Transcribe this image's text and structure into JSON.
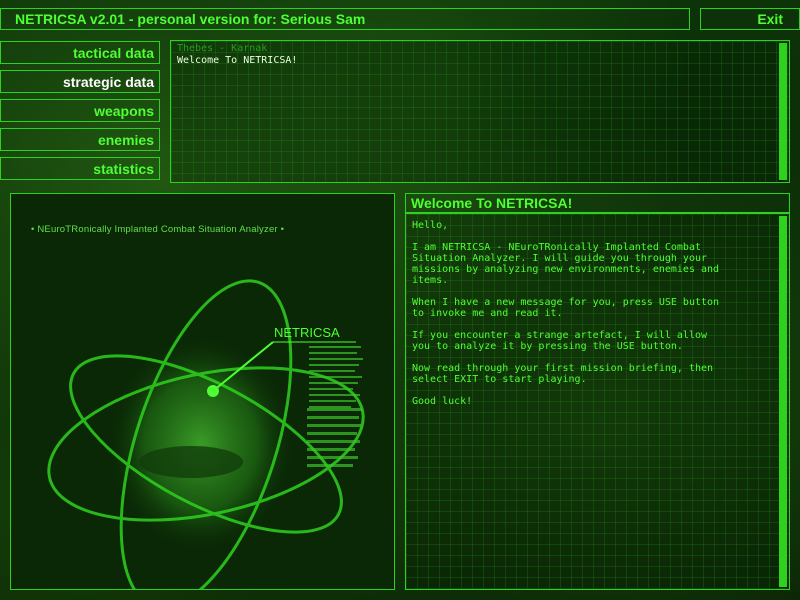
{
  "header": {
    "title": "NETRICSA v2.01 - personal version for: Serious Sam",
    "exit_label": "Exit"
  },
  "nav": {
    "items": [
      {
        "label": "tactical data",
        "active": false
      },
      {
        "label": "strategic data",
        "active": true
      },
      {
        "label": "weapons",
        "active": false
      },
      {
        "label": "enemies",
        "active": false
      },
      {
        "label": "statistics",
        "active": false
      }
    ]
  },
  "messages": {
    "location": "Thebes - Karnak",
    "subject": "Welcome To NETRICSA!"
  },
  "image": {
    "caption": "• NEuroTRonically Implanted Combat Situation Analyzer •",
    "label": "NETRICSA"
  },
  "message": {
    "title": "Welcome To NETRICSA!",
    "body": "Hello,\n\nI am NETRICSA - NEuroTRonically Implanted Combat\nSituation Analyzer. I will guide you through your\nmissions by analyzing new environments, enemies and\nitems.\n\nWhen I have a new message for you, press USE button\nto invoke me and read it.\n\nIf you encounter a strange artefact, I will allow\nyou to analyze it by pressing the USE button.\n\nNow read through your first mission briefing, then\nselect EXIT to start playing.\n\nGood luck!"
  },
  "colors": {
    "accent": "#4dff33",
    "border": "#2fd11f",
    "active_text": "#ffffff",
    "background": "#0d3309"
  }
}
